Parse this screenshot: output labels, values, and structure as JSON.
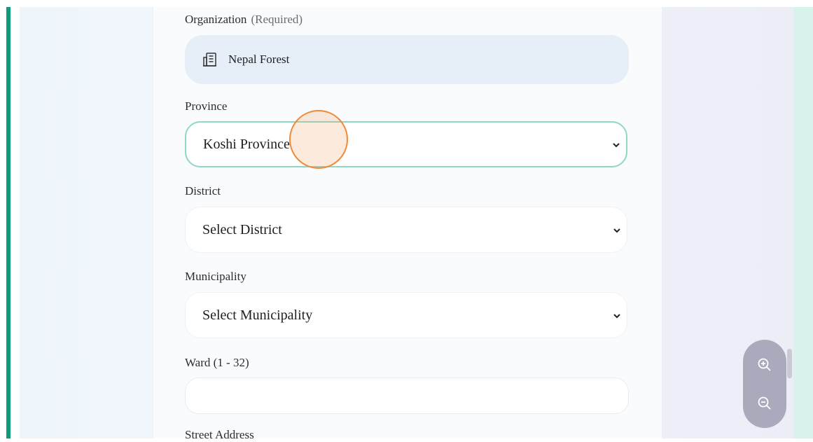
{
  "form": {
    "organization": {
      "label": "Organization",
      "required_hint": "(Required)",
      "value": "Nepal Forest",
      "icon": "building-icon"
    },
    "province": {
      "label": "Province",
      "selected": "Koshi Province",
      "icon": "chevron-down-icon"
    },
    "district": {
      "label": "District",
      "selected": "Select District",
      "icon": "chevron-down-icon"
    },
    "municipality": {
      "label": "Municipality",
      "selected": "Select Municipality",
      "icon": "chevron-down-icon"
    },
    "ward": {
      "label": "Ward (1 - 32)",
      "value": ""
    },
    "street_address": {
      "label": "Street Address"
    }
  },
  "zoom_controls": {
    "zoom_in_icon": "zoom-in-icon",
    "zoom_out_icon": "zoom-out-icon"
  },
  "colors": {
    "accent_green": "#0f9a78",
    "active_border": "#8fd6c6",
    "cursor_ring": "#ef8a3a",
    "org_box_bg": "#e6eef8",
    "zoom_pill_bg": "#a9abbd"
  }
}
